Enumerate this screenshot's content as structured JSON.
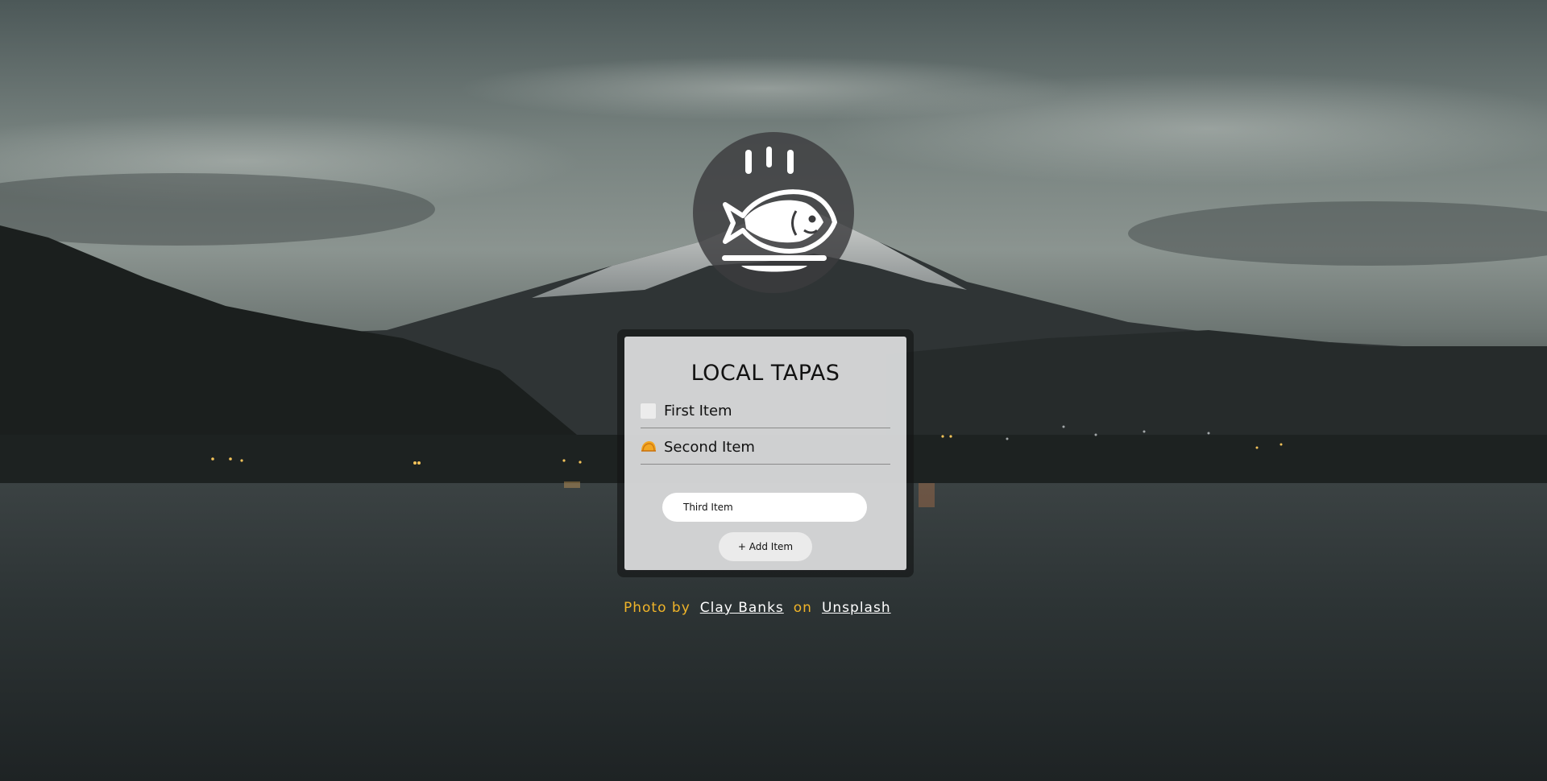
{
  "background": {
    "description_icon": "mountain-lake-photo"
  },
  "logo": {
    "icon": "fish-dish-icon"
  },
  "card": {
    "title": "LOCAL TAPAS",
    "items": [
      {
        "label": "First Item",
        "checked": false
      },
      {
        "label": "Second Item",
        "icon": "taco-icon"
      }
    ],
    "input": {
      "value": "Third Item",
      "placeholder": ""
    },
    "add_button_label": "+ Add Item"
  },
  "credit": {
    "prefix": "Photo by",
    "author": "Clay Banks",
    "middle": "on",
    "site": "Unsplash"
  },
  "colors": {
    "accent": "#f0b429",
    "card_bg": "#dedfe0",
    "link": "#ffffff"
  }
}
